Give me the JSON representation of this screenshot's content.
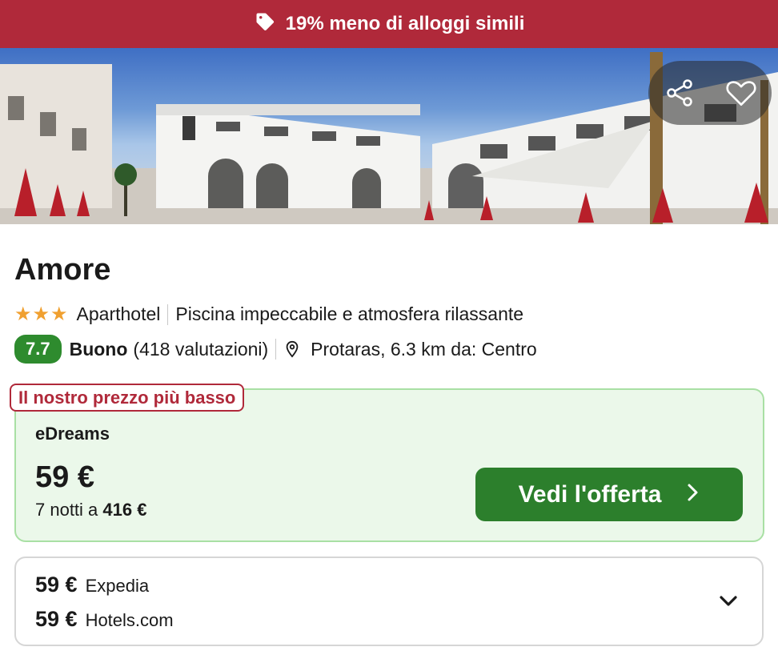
{
  "banner": {
    "text": "19% meno di alloggi simili",
    "icon": "tag-icon",
    "color": "#b0293a"
  },
  "hero": {
    "image": "hotel-photo",
    "actions": [
      "share-icon",
      "heart-icon"
    ]
  },
  "hotel": {
    "name": "Amore",
    "stars": 3,
    "stars_glyph": "★★★",
    "type": "Aparthotel",
    "highlight": "Piscina impeccabile e atmosfera rilassante",
    "score": "7.7",
    "rating_word": "Buono",
    "reviews": "(418 valutazioni)",
    "location": "Protaras, 6.3 km da: Centro",
    "location_icon": "map-pin-icon"
  },
  "best_offer": {
    "label": "Il nostro prezzo più basso",
    "provider": "eDreams",
    "price": "59 €",
    "nights_prefix": "7 notti a",
    "nights_total": "416 €",
    "cta": "Vedi l'offerta",
    "accent": "#2c7f2c"
  },
  "other_offers": [
    {
      "price": "59 €",
      "provider": "Expedia"
    },
    {
      "price": "59 €",
      "provider": "Hotels.com"
    }
  ]
}
